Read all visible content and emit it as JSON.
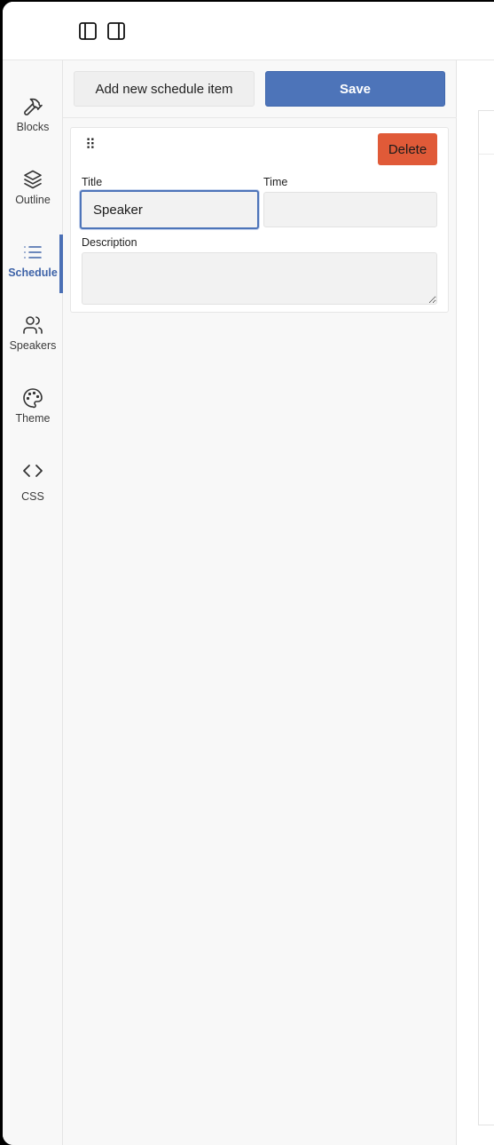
{
  "rail": {
    "items": [
      {
        "label": "Blocks",
        "icon": "hammer-icon"
      },
      {
        "label": "Outline",
        "icon": "layers-icon"
      },
      {
        "label": "Schedule",
        "icon": "list-icon"
      },
      {
        "label": "Speakers",
        "icon": "users-icon"
      },
      {
        "label": "Theme",
        "icon": "palette-icon"
      },
      {
        "label": "CSS",
        "icon": "code-icon"
      }
    ],
    "active": "Schedule"
  },
  "topbar": {
    "left_panel_icon": "panel-left-icon",
    "right_panel_icon": "panel-right-icon"
  },
  "toolbar": {
    "add_label": "Add new schedule item",
    "save_label": "Save"
  },
  "schedule_item": {
    "drag_glyph": "⠿",
    "delete_label": "Delete",
    "title_label": "Title",
    "title_value": "Speaker ",
    "time_label": "Time",
    "time_value": "",
    "description_label": "Description",
    "description_value": ""
  },
  "colors": {
    "accent": "#4d74b9",
    "active_text": "#3e63a8",
    "danger": "#e05a38"
  }
}
